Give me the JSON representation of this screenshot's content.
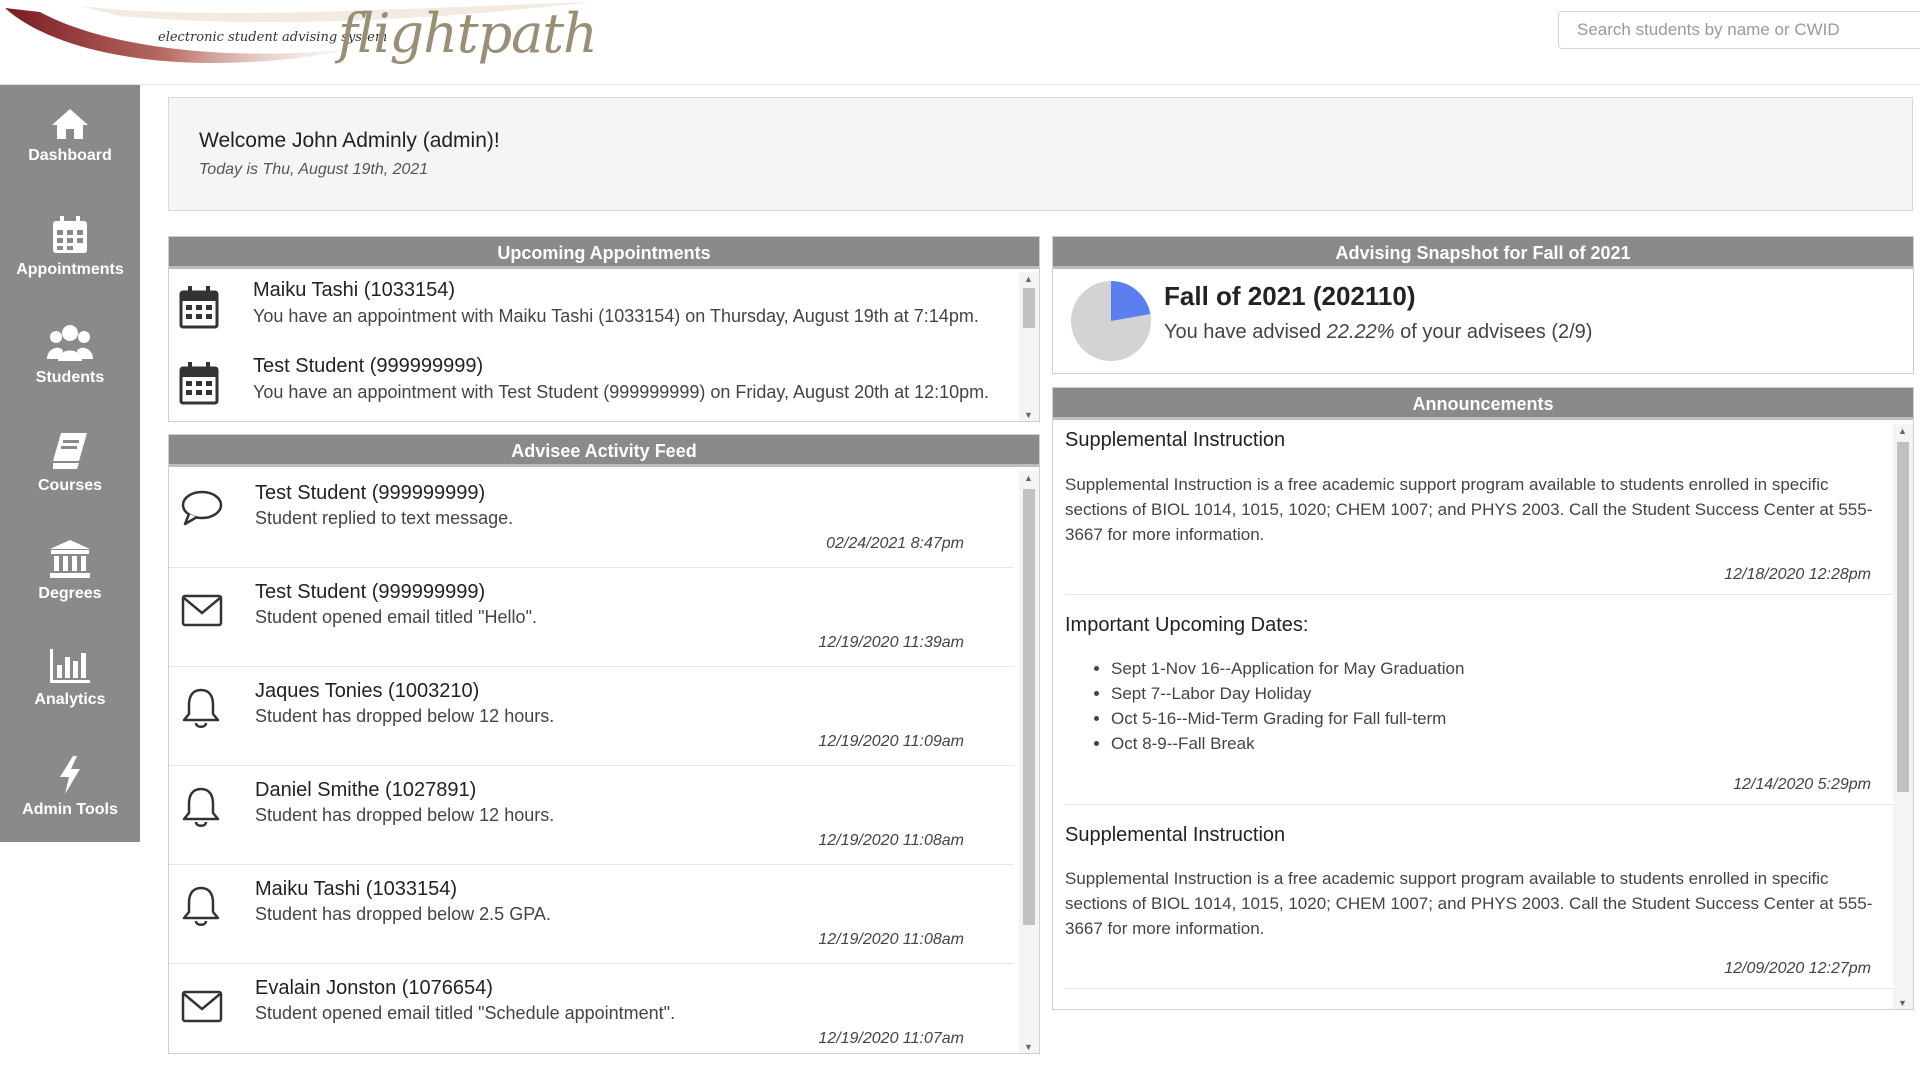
{
  "logo": {
    "small_text": "electronic student advising system",
    "brand": "flightpath"
  },
  "search": {
    "placeholder": "Search students by name or CWID"
  },
  "sidebar": {
    "items": [
      {
        "label": "Dashboard",
        "icon": "home-icon"
      },
      {
        "label": "Appointments",
        "icon": "calendar-icon"
      },
      {
        "label": "Students",
        "icon": "users-icon"
      },
      {
        "label": "Courses",
        "icon": "book-icon"
      },
      {
        "label": "Degrees",
        "icon": "institution-icon"
      },
      {
        "label": "Analytics",
        "icon": "bar-chart-icon"
      },
      {
        "label": "Admin Tools",
        "icon": "bolt-icon"
      }
    ]
  },
  "welcome": {
    "title": "Welcome John Adminly (admin)!",
    "date": "Today is Thu, August 19th, 2021"
  },
  "appointments": {
    "heading": "Upcoming Appointments",
    "items": [
      {
        "name": "Maiku Tashi (1033154)",
        "text": "You have an appointment with Maiku Tashi (1033154) on Thursday, August 19th at 7:14pm."
      },
      {
        "name": "Test Student (999999999)",
        "text": "You have an appointment with Test Student (999999999) on Friday, August 20th at 12:10pm."
      }
    ]
  },
  "feed": {
    "heading": "Advisee Activity Feed",
    "items": [
      {
        "icon": "comment-icon",
        "name": "Test Student (999999999)",
        "text": "Student replied to text message.",
        "time": "02/24/2021 8:47pm"
      },
      {
        "icon": "envelope-icon",
        "name": "Test Student (999999999)",
        "text": "Student opened email titled \"Hello\".",
        "time": "12/19/2020 11:39am"
      },
      {
        "icon": "bell-icon",
        "name": "Jaques Tonies (1003210)",
        "text": "Student has dropped below 12 hours.",
        "time": "12/19/2020 11:09am"
      },
      {
        "icon": "bell-icon",
        "name": "Daniel Smithe (1027891)",
        "text": "Student has dropped below 12 hours.",
        "time": "12/19/2020 11:08am"
      },
      {
        "icon": "bell-icon",
        "name": "Maiku Tashi (1033154)",
        "text": "Student has dropped below 2.5 GPA.",
        "time": "12/19/2020 11:08am"
      },
      {
        "icon": "envelope-icon",
        "name": "Evalain Jonston (1076654)",
        "text": "Student opened email titled \"Schedule appointment\".",
        "time": "12/19/2020 11:07am"
      }
    ]
  },
  "snapshot": {
    "heading": "Advising Snapshot for Fall of 2021",
    "term": "Fall of 2021 (202110)",
    "text_prefix": "You have advised ",
    "percent": "22.22%",
    "text_suffix": " of your advisees (2/9)",
    "advised_fraction": 0.2222,
    "colors": {
      "advised": "#5b7ff0",
      "remaining": "#d3d3d3"
    }
  },
  "announcements": {
    "heading": "Announcements",
    "items": [
      {
        "title": "Supplemental Instruction",
        "body": "Supplemental Instruction is a free academic support program available to students enrolled in specific sections of BIOL 1014, 1015, 1020; CHEM 1007; and PHYS 2003. Call the Student Success Center at 555-3667 for more information.",
        "date": "12/18/2020 12:28pm"
      },
      {
        "title": "Important Upcoming Dates:",
        "list": [
          "Sept 1-Nov 16--Application for May Graduation",
          "Sept 7--Labor Day Holiday",
          "Oct 5-16--Mid-Term Grading for Fall full-term",
          "Oct 8-9--Fall Break"
        ],
        "date": "12/14/2020 5:29pm"
      },
      {
        "title": "Supplemental Instruction",
        "body": "Supplemental Instruction is a free academic support program available to students enrolled in specific sections of BIOL 1014, 1015, 1020; CHEM 1007; and PHYS 2003. Call the Student Success Center at 555-3667 for more information.",
        "date": "12/09/2020 12:27pm"
      }
    ]
  }
}
